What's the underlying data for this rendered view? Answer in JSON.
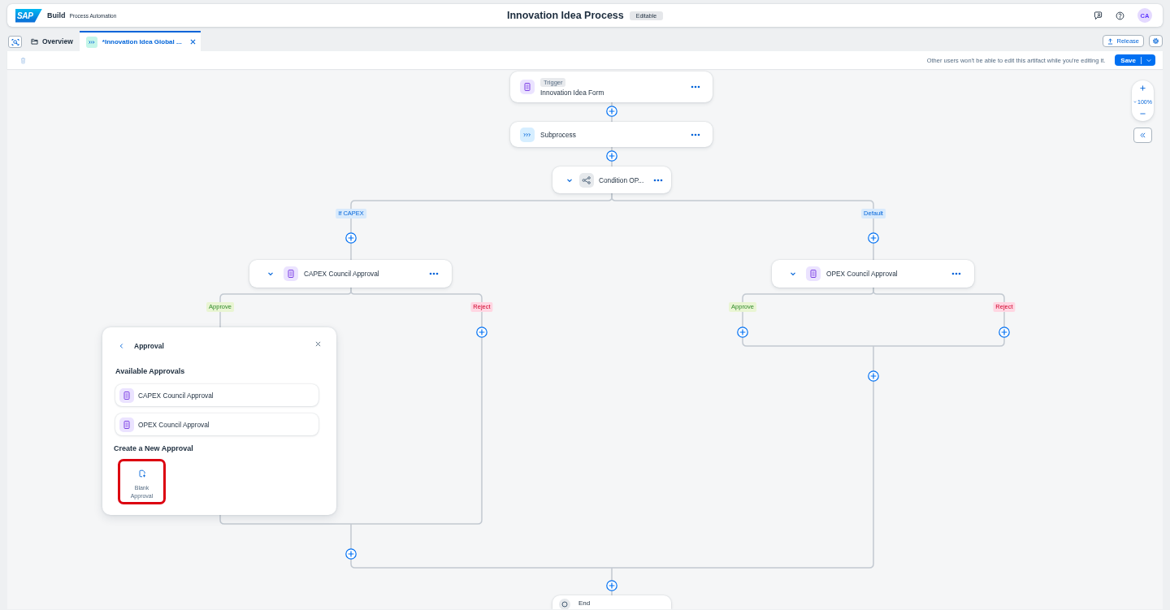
{
  "header": {
    "logo": "SAP",
    "product": "Build",
    "subtitle": "Process Automation",
    "title": "Innovation Idea Process",
    "status": "Editable",
    "avatar": "CA"
  },
  "tabs": [
    {
      "label": "Overview",
      "kind": "overview",
      "selected": false,
      "closable": false
    },
    {
      "label": "*Innovation Idea Global ...",
      "kind": "process",
      "selected": true,
      "closable": true
    }
  ],
  "release": {
    "label": "Release"
  },
  "toolbar": {
    "delete_disabled": true,
    "notice": "Other users won't be able to edit this artifact while you're editing it.",
    "save": "Save"
  },
  "zoom": {
    "reading": "100%"
  },
  "flow": {
    "steps": [
      {
        "kind": "trigger",
        "tag": "Trigger",
        "label": "Innovation Idea Form"
      },
      {
        "kind": "subprocess",
        "label": "Subprocess"
      }
    ],
    "condition": {
      "label": "Condition OP...",
      "expanded": true,
      "branches": [
        {
          "label": "If CAPEX",
          "approval": {
            "label": "CAPEX Council Approval",
            "expanded": true
          },
          "outcomes": [
            {
              "label": "Approve",
              "kind": "approve",
              "picker": {
                "title": "Approval",
                "available_heading": "Available Approvals",
                "available": [
                  {
                    "label": "CAPEX Council Approval"
                  },
                  {
                    "label": "OPEX Council Approval"
                  }
                ],
                "create_heading": "Create a New Approval",
                "templates": [
                  {
                    "label": "Blank Approval",
                    "highlighted": true
                  }
                ]
              }
            },
            {
              "label": "Reject",
              "kind": "reject"
            }
          ]
        },
        {
          "label": "Default",
          "approval": {
            "label": "OPEX Council Approval",
            "expanded": true
          },
          "outcomes": [
            {
              "label": "Approve",
              "kind": "approve"
            },
            {
              "label": "Reject",
              "kind": "reject"
            }
          ]
        }
      ]
    },
    "end": {
      "label": "End"
    }
  }
}
